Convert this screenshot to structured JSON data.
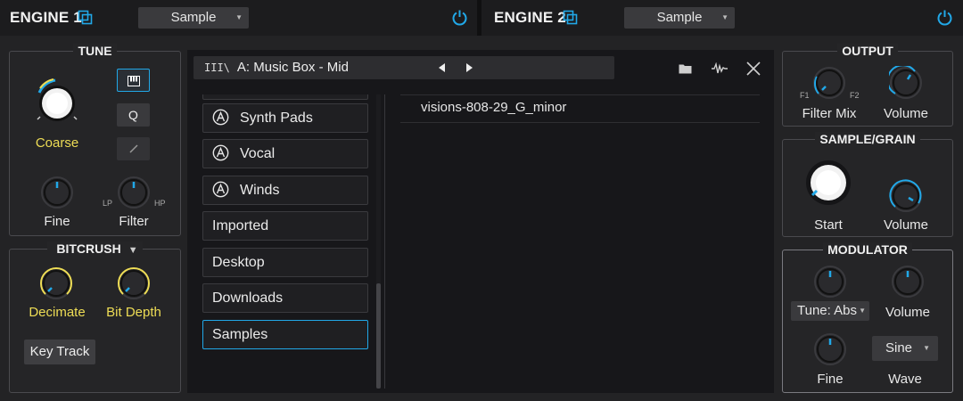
{
  "engine1": {
    "title": "ENGINE 1",
    "source": "Sample",
    "icons": {
      "copy": "copy-icon",
      "power": "power-icon"
    },
    "accent": "#21a8e8"
  },
  "engine2": {
    "title": "ENGINE 2",
    "source": "Sample",
    "icons": {
      "copy": "copy-icon",
      "power": "power-icon"
    }
  },
  "tune": {
    "title": "TUNE",
    "coarse": {
      "label": "Coarse"
    },
    "fine": {
      "label": "Fine"
    },
    "filter": {
      "label": "Filter",
      "low": "LP",
      "high": "HP"
    },
    "buttons": {
      "keyboard_icon": "keyboard-icon",
      "q": "Q",
      "pen_icon": "pencil-icon"
    }
  },
  "bitcrush": {
    "title": "BITCRUSH",
    "decimate": {
      "label": "Decimate"
    },
    "bit_depth": {
      "label": "Bit Depth"
    },
    "key_track": "Key Track"
  },
  "browser": {
    "path": "A:  Music Box - Mid",
    "path_icon": "library-icon",
    "nav": {
      "prev": "◀",
      "next": "▶"
    },
    "toolbar_icons": [
      "folder-icon",
      "waveform-icon",
      "close-icon"
    ],
    "categories": [
      {
        "label": "Synth Pads",
        "icon": "arturia-logo-icon"
      },
      {
        "label": "Vocal",
        "icon": "arturia-logo-icon"
      },
      {
        "label": "Winds",
        "icon": "arturia-logo-icon"
      },
      {
        "label": "Imported"
      },
      {
        "label": "Desktop"
      },
      {
        "label": "Downloads"
      },
      {
        "label": "Samples",
        "selected": true
      }
    ],
    "files": [
      "visions-808-29_G_minor"
    ]
  },
  "output": {
    "title": "OUTPUT",
    "filter_mix": {
      "label": "Filter Mix",
      "low": "F1",
      "high": "F2"
    },
    "volume": {
      "label": "Volume"
    }
  },
  "sample_grain": {
    "title": "SAMPLE/GRAIN",
    "start": {
      "label": "Start"
    },
    "volume": {
      "label": "Volume"
    }
  },
  "modulator": {
    "title": "MODULATOR",
    "tune_mode": "Tune: Abs",
    "volume": {
      "label": "Volume"
    },
    "fine": {
      "label": "Fine"
    },
    "wave_select": "Sine",
    "wave": {
      "label": "Wave"
    }
  },
  "colors": {
    "accent_blue": "#21a8e8",
    "accent_yellow": "#eedd55",
    "panel_bg": "#252527"
  }
}
